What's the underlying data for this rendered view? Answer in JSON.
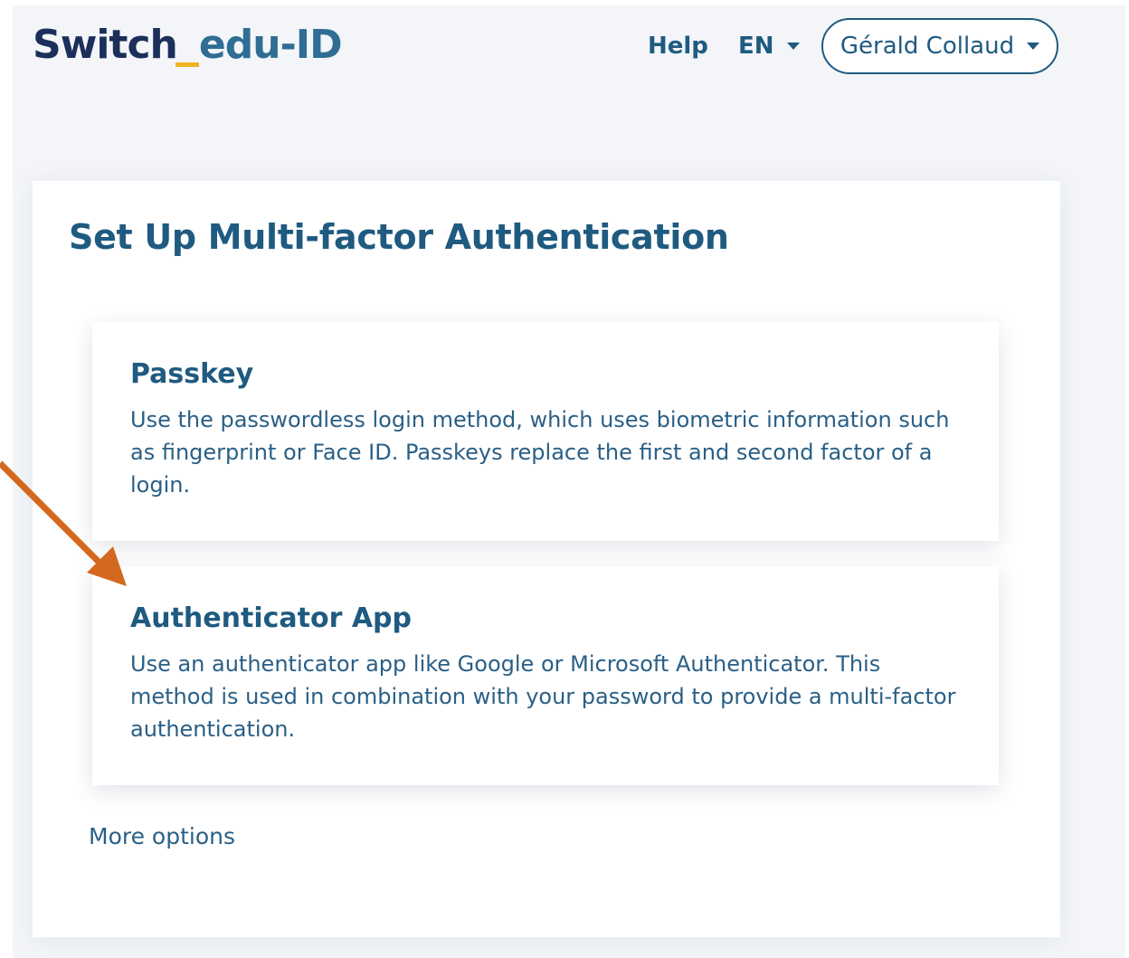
{
  "header": {
    "logo_primary": "Switch",
    "logo_secondary": "edu-ID",
    "help_label": "Help",
    "language": "EN",
    "user_name": "Gérald Collaud"
  },
  "main": {
    "title": "Set Up Multi-factor Authentication",
    "options": [
      {
        "title": "Passkey",
        "description": "Use the passwordless login method, which uses biometric information such as fingerprint or Face ID. Passkeys replace the first and second factor of a login."
      },
      {
        "title": "Authenticator App",
        "description": "Use an authenticator app like Google or Microsoft Authenticator. This method is used in combination with your password to provide a multi-factor authentication."
      }
    ],
    "more_options_label": "More options"
  },
  "colors": {
    "brand_dark": "#1b2f5a",
    "brand_blue": "#1f5a80",
    "accent_yellow": "#f0b323",
    "annotation_arrow": "#d2691e"
  },
  "icons": {
    "language_dropdown": "chevron-down-icon",
    "user_dropdown": "chevron-down-icon",
    "annotation": "arrow-annotation-icon"
  }
}
